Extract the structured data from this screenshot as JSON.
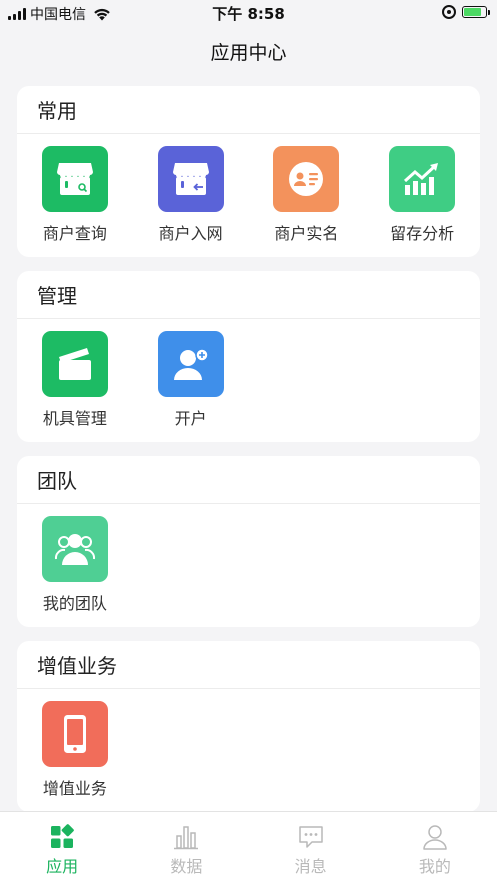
{
  "status_bar": {
    "carrier": "中国电信",
    "time": "下午 8:58",
    "battery_level": 0.8,
    "icons": [
      "signal-icon",
      "wifi-icon",
      "orientation-lock-icon",
      "battery-charging-icon"
    ]
  },
  "nav": {
    "title": "应用中心"
  },
  "sections": [
    {
      "title": "常用",
      "items": [
        {
          "label": "商户查询",
          "icon": "store-search-icon",
          "color": "#1dbb64"
        },
        {
          "label": "商户入网",
          "icon": "store-join-icon",
          "color": "#5a63d8"
        },
        {
          "label": "商户实名",
          "icon": "id-card-icon",
          "color": "#f3925c"
        },
        {
          "label": "留存分析",
          "icon": "trend-chart-icon",
          "color": "#3fcd84"
        }
      ]
    },
    {
      "title": "管理",
      "items": [
        {
          "label": "机具管理",
          "icon": "card-machine-icon",
          "color": "#1dbb64"
        },
        {
          "label": "开户",
          "icon": "add-user-icon",
          "color": "#3f8fea"
        }
      ]
    },
    {
      "title": "团队",
      "items": [
        {
          "label": "我的团队",
          "icon": "team-icon",
          "color": "#4fcf94"
        }
      ]
    },
    {
      "title": "增值业务",
      "items": [
        {
          "label": "增值业务",
          "icon": "phone-icon",
          "color": "#f16d5a"
        }
      ]
    }
  ],
  "tabbar": {
    "active_color": "#1bb35e",
    "inactive_color": "#b9b9b9",
    "tabs": [
      {
        "label": "应用",
        "icon": "apps-grid-icon",
        "active": true
      },
      {
        "label": "数据",
        "icon": "bar-chart-icon",
        "active": false
      },
      {
        "label": "消息",
        "icon": "message-icon",
        "active": false
      },
      {
        "label": "我的",
        "icon": "user-icon",
        "active": false
      }
    ]
  }
}
